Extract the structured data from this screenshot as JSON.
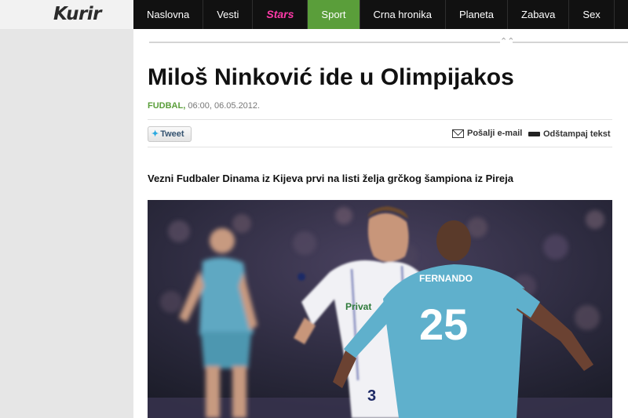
{
  "header": {
    "logo_text": "Kurir",
    "nav": [
      {
        "label": "Naslovna",
        "active": false
      },
      {
        "label": "Vesti",
        "active": false
      },
      {
        "label": "Stars",
        "active": false
      },
      {
        "label": "Sport",
        "active": true
      },
      {
        "label": "Crna hronika",
        "active": false
      },
      {
        "label": "Planeta",
        "active": false
      },
      {
        "label": "Zabava",
        "active": false
      },
      {
        "label": "Sex",
        "active": false
      }
    ]
  },
  "article": {
    "title": "Miloš Ninković ide u Olimpijakos",
    "category": "FUDBAL,",
    "datetime": "06:00, 06.05.2012.",
    "tweet_label": "Tweet",
    "email_label": "Pošalji e-mail",
    "print_label": "Odštampaj tekst",
    "lead": "Vezni Fudbaler Dinama iz Kijeva prvi na listi želja grčkog šampiona iz Pireja",
    "photo": {
      "jersey_name": "FERNANDO",
      "jersey_number": "25",
      "shorts_number": "3",
      "sponsor": "Privat"
    }
  },
  "colors": {
    "nav_bg": "#111111",
    "active_tab": "#5a9e3a",
    "stars_pink": "#ff3aa8",
    "category_green": "#5a9e3a"
  },
  "icons": [
    "collapse-up-icon",
    "twitter-bird-icon",
    "envelope-icon",
    "printer-icon"
  ]
}
